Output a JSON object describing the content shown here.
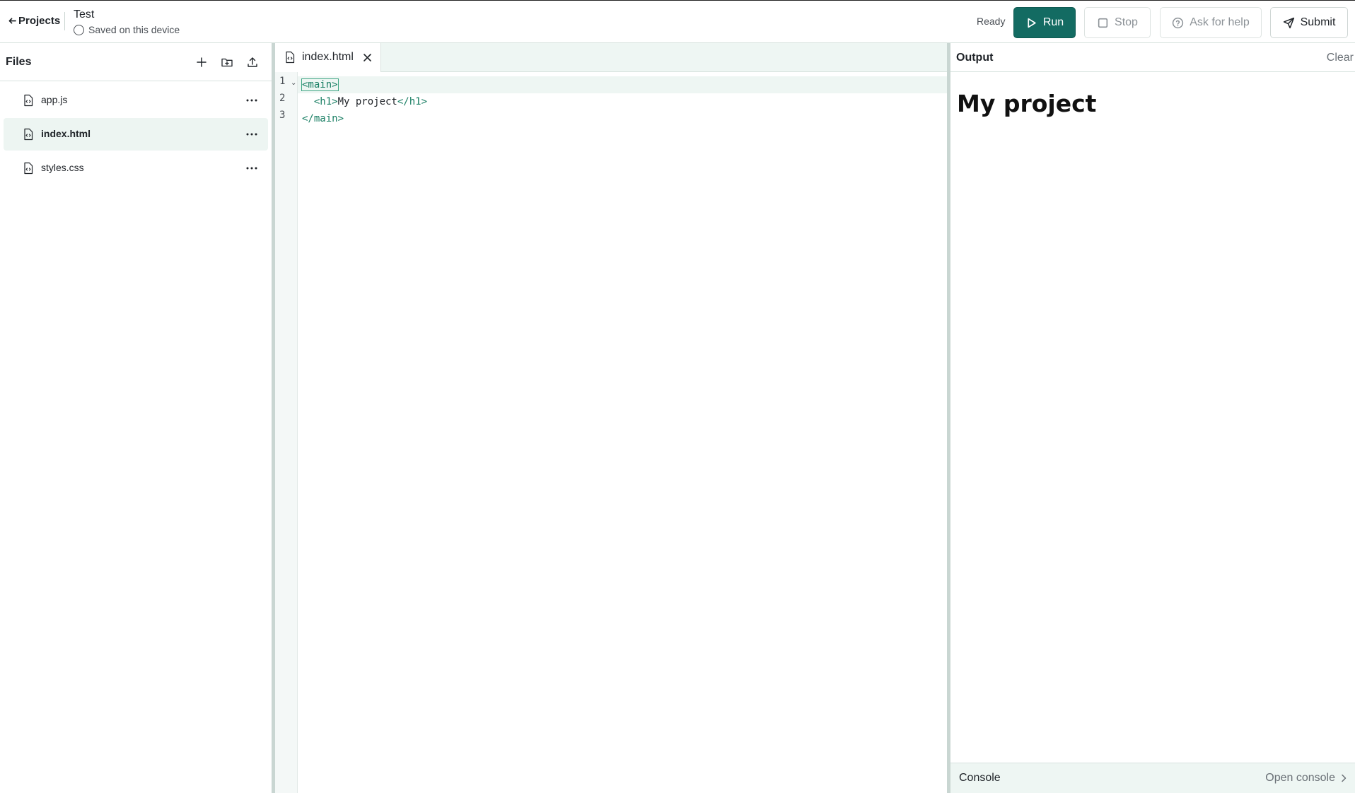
{
  "header": {
    "back_label": "Projects",
    "project_title": "Test",
    "save_status": "Saved on this device",
    "run_status": "Ready",
    "run_label": "Run",
    "stop_label": "Stop",
    "help_label": "Ask for help",
    "submit_label": "Submit"
  },
  "sidebar": {
    "title": "Files",
    "files": [
      {
        "name": "app.js"
      },
      {
        "name": "index.html"
      },
      {
        "name": "styles.css"
      }
    ],
    "active_file": "index.html"
  },
  "editor": {
    "tab_label": "index.html",
    "line_numbers": [
      "1",
      "2",
      "3"
    ],
    "lines": [
      {
        "open": "<main>"
      },
      {
        "indent": "  ",
        "open": "<h1>",
        "text": "My project",
        "close": "</h1>"
      },
      {
        "close": "</main>"
      }
    ]
  },
  "output": {
    "title": "Output",
    "clear_label": "Clear",
    "preview_heading": "My project",
    "console_label": "Console",
    "open_console_label": "Open console"
  },
  "colors": {
    "accent": "#136b62",
    "tag": "#1a7f64",
    "active_bg": "#edf5f2"
  }
}
